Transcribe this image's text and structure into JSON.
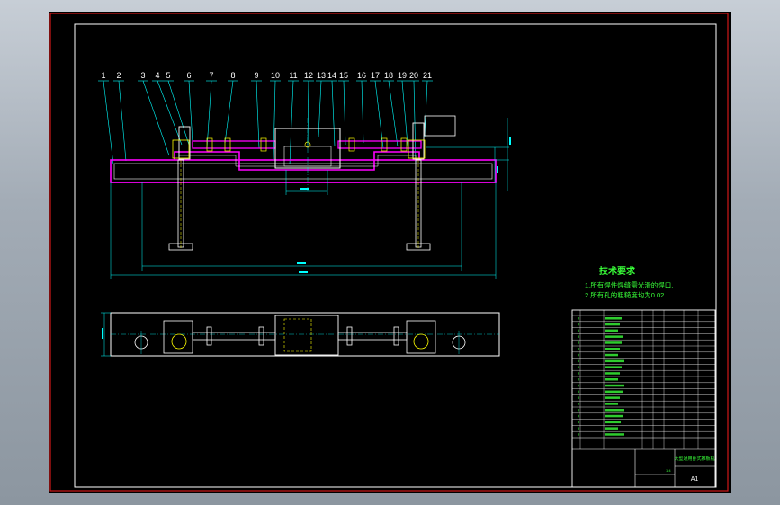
{
  "colors": {
    "background": "#a3acb6",
    "sheet": "#000000",
    "outer_border": "#d01818",
    "inner_border": "#ffffff",
    "outline": "#ffffff",
    "section_fill": "#ff00ff",
    "leader": "#00ffff",
    "dimension": "#00ffff",
    "notes": "#39ff39",
    "title_block": "#ffffff",
    "table_text": "#39ff39",
    "sub_parts": "#ffff00"
  },
  "part_callouts": [
    "1",
    "2",
    "3",
    "4",
    "5",
    "6",
    "7",
    "8",
    "9",
    "10",
    "11",
    "12",
    "13",
    "14",
    "15",
    "16",
    "17",
    "18",
    "19",
    "20",
    "21"
  ],
  "technical_requirements": {
    "title": "技术要求",
    "items": [
      "1.所有焊件焊缝需光滑的焊口.",
      "2.所有孔的粗糙度均为0.02."
    ]
  },
  "title_block": {
    "drawing_title": "大型通用卧式推板机",
    "sheet_no": "A1",
    "scale": "1:4"
  }
}
